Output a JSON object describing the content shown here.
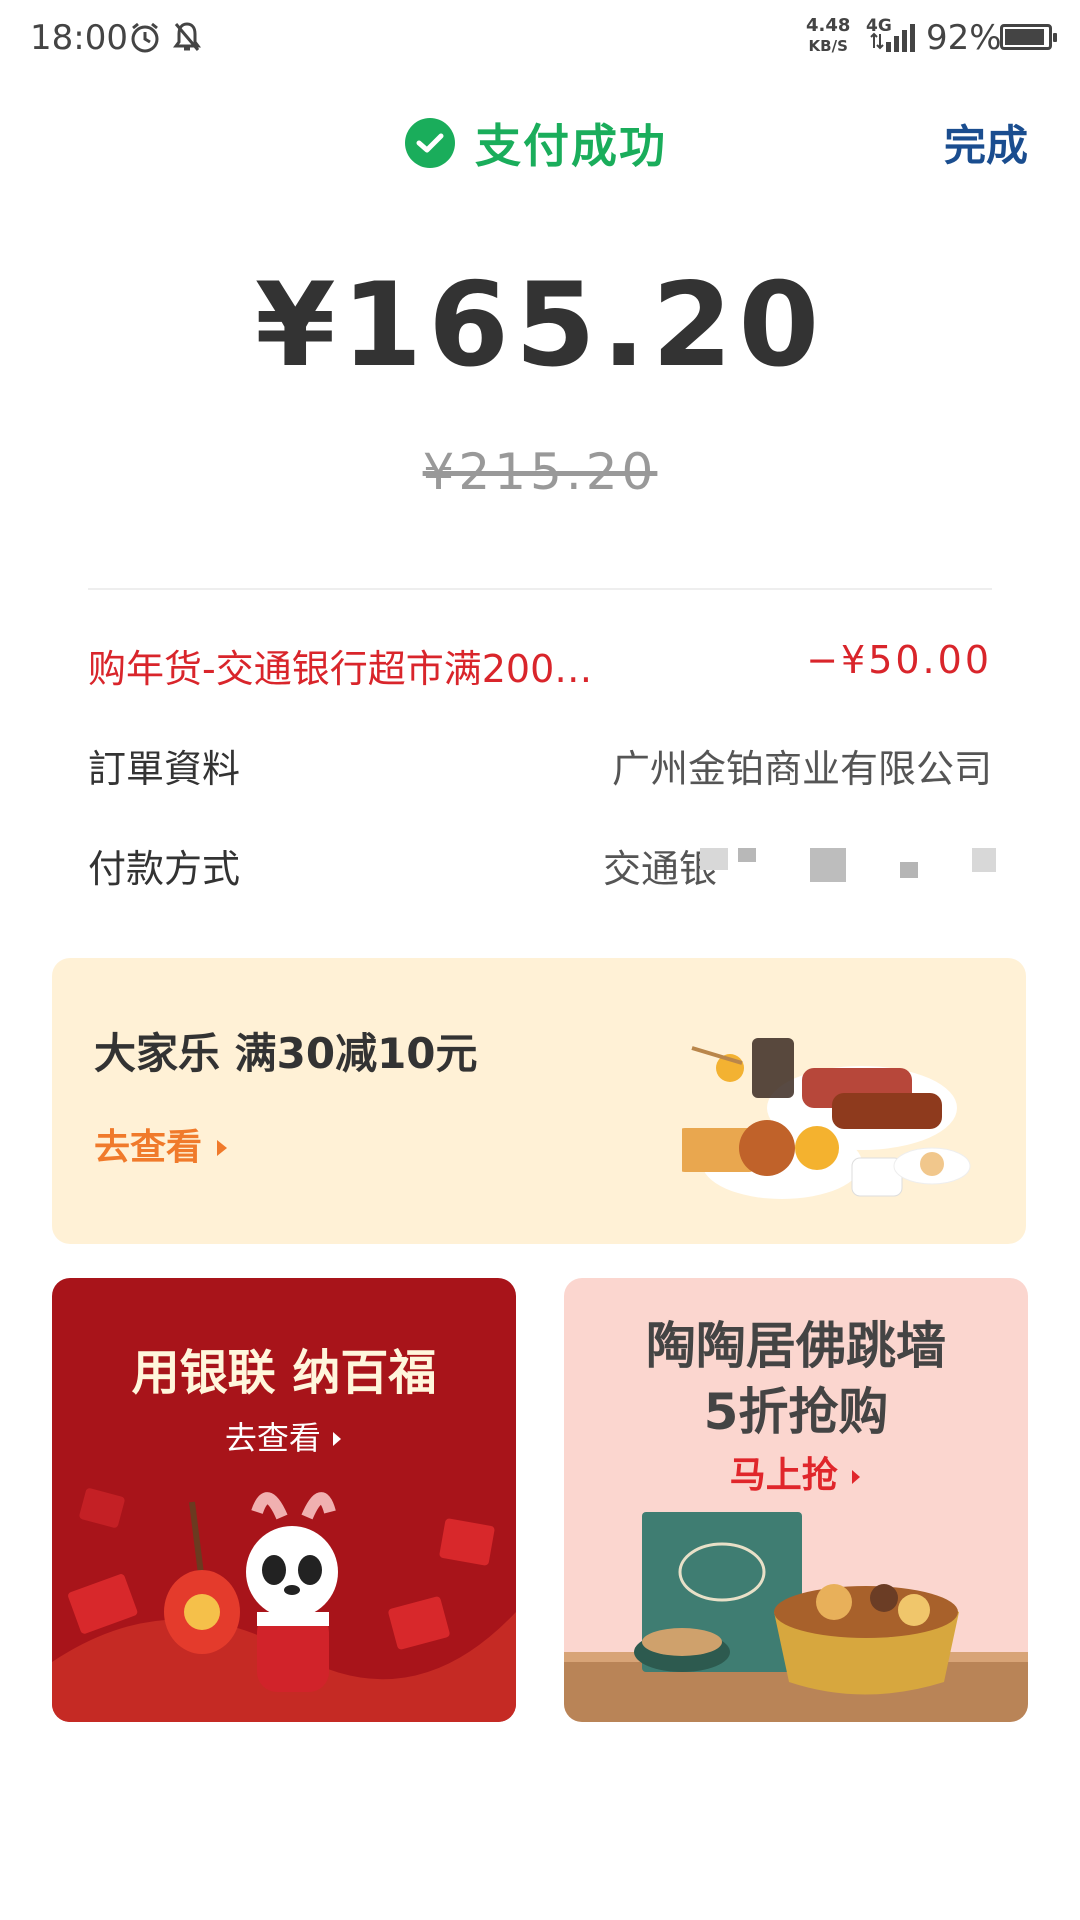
{
  "status_bar": {
    "time": "18:00",
    "speed_value": "4.48",
    "speed_unit": "KB/S",
    "network": "4G",
    "battery_percent": "92%",
    "battery_level": 0.92
  },
  "header": {
    "title": "支付成功",
    "done_label": "完成"
  },
  "payment": {
    "amount": "¥165.20",
    "original_amount": "¥215.20"
  },
  "details": {
    "promo_label": "购年货-交通银行超市满200…",
    "promo_value": "−¥50.00",
    "order_label": "訂單資料",
    "order_value": "广州金铂商业有限公司",
    "payment_method_label": "付款方式",
    "payment_method_value": "交通银"
  },
  "banners": {
    "wide": {
      "title": "大家乐 满30减10元",
      "link": "去查看"
    },
    "left": {
      "title": "用银联 纳百福",
      "link": "去查看"
    },
    "right": {
      "title_line1": "陶陶居佛跳墙",
      "title_line2": "5折抢购",
      "link": "马上抢"
    }
  },
  "colors": {
    "success_green": "#1aad5b",
    "promo_red": "#d9252b",
    "link_blue": "#1a4d8f"
  }
}
